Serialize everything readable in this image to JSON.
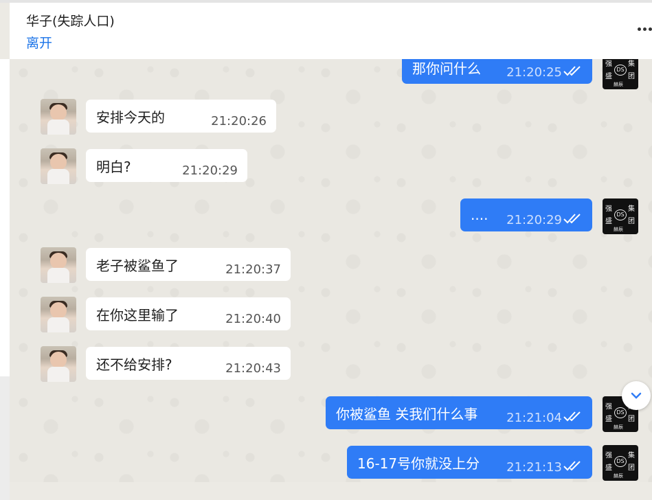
{
  "header": {
    "contact_name": "华子(失踪人口)",
    "status": "离开",
    "menu_icon": "more-dots-icon"
  },
  "messages": [
    {
      "direction": "out",
      "text": "那你问什么",
      "time": "21:20:25",
      "status": "read"
    },
    {
      "direction": "in",
      "text": "安排今天的",
      "time": "21:20:26"
    },
    {
      "direction": "in",
      "text": "明白?",
      "time": "21:20:29"
    },
    {
      "direction": "out",
      "text": "....",
      "time": "21:20:29",
      "status": "read"
    },
    {
      "direction": "in",
      "text": "老子被鲨鱼了",
      "time": "21:20:37"
    },
    {
      "direction": "in",
      "text": "在你这里输了",
      "time": "21:20:40"
    },
    {
      "direction": "in",
      "text": "还不给安排?",
      "time": "21:20:43"
    },
    {
      "direction": "out",
      "text": "你被鲨鱼 关我们什么事",
      "time": "21:21:04",
      "status": "read"
    },
    {
      "direction": "out",
      "text": "16-17号你就没上分",
      "time": "21:21:13",
      "status": "read"
    }
  ],
  "avatars": {
    "incoming_icon": "child-photo-avatar",
    "outgoing_icon": "ds-group-logo-avatar",
    "outgoing_logo_text": [
      "强",
      "盛",
      "集",
      "团",
      "DS",
      "赫辰"
    ]
  },
  "colors": {
    "outgoing_bubble": "#2f7cf6",
    "incoming_bubble": "#ffffff",
    "chat_background": "#eae8e2",
    "status_text": "#1a73e8"
  },
  "scroll_button_icon": "chevron-down-icon"
}
